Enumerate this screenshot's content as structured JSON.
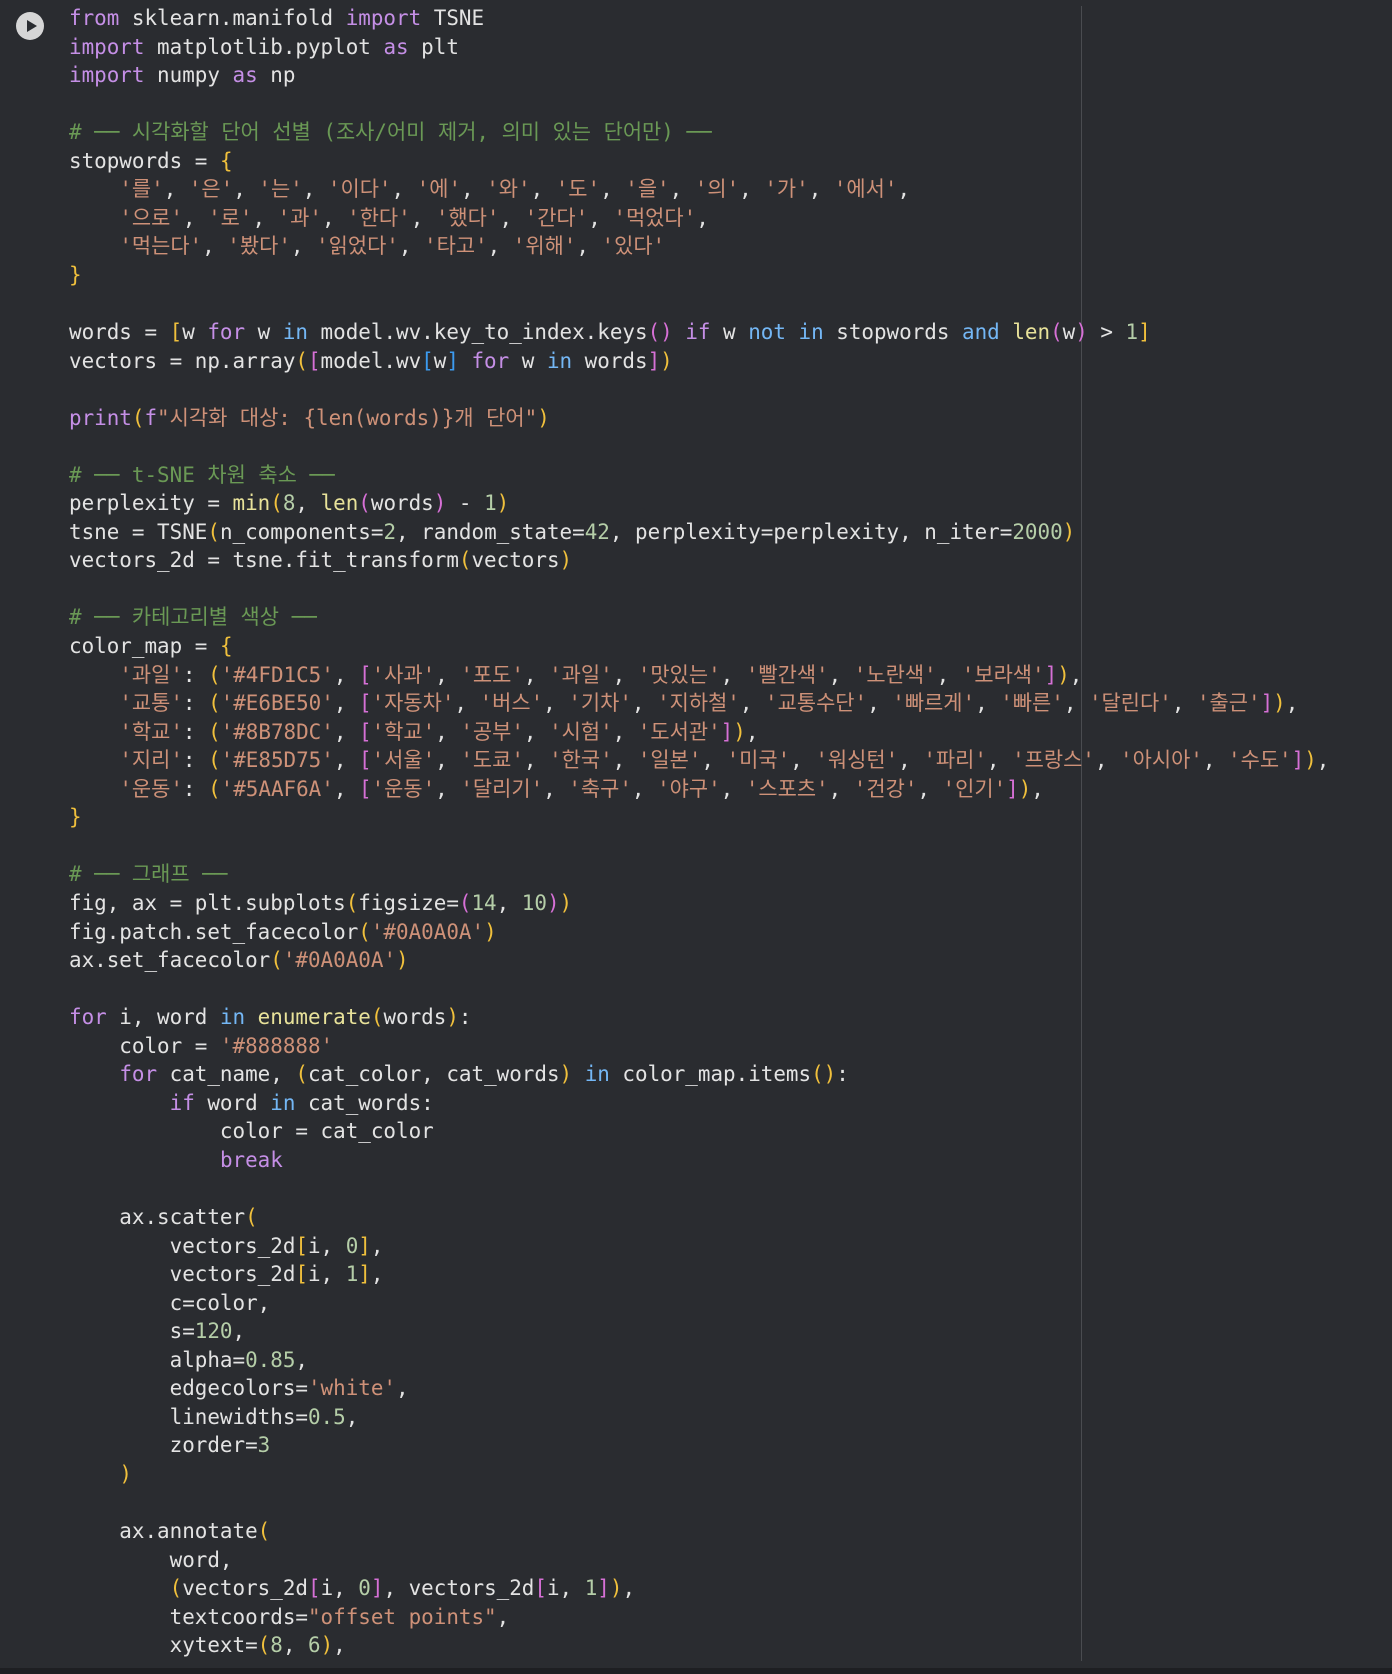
{
  "cell": {
    "run_icon": "play-icon",
    "lines": [
      "from sklearn.manifold import TSNE",
      "import matplotlib.pyplot as plt",
      "import numpy as np",
      "",
      "# ── 시각화할 단어 선별 (조사/어미 제거, 의미 있는 단어만) ──",
      "stopwords = {",
      "    '를', '은', '는', '이다', '에', '와', '도', '을', '의', '가', '에서',",
      "    '으로', '로', '과', '한다', '했다', '간다', '먹었다',",
      "    '먹는다', '봤다', '읽었다', '타고', '위해', '있다'",
      "}",
      "",
      "words = [w for w in model.wv.key_to_index.keys() if w not in stopwords and len(w) > 1]",
      "vectors = np.array([model.wv[w] for w in words])",
      "",
      "print(f\"시각화 대상: {len(words)}개 단어\")",
      "",
      "# ── t-SNE 차원 축소 ──",
      "perplexity = min(8, len(words) - 1)",
      "tsne = TSNE(n_components=2, random_state=42, perplexity=perplexity, n_iter=2000)",
      "vectors_2d = tsne.fit_transform(vectors)",
      "",
      "# ── 카테고리별 색상 ──",
      "color_map = {",
      "    '과일': ('#4FD1C5', ['사과', '포도', '과일', '맛있는', '빨간색', '노란색', '보라색']),",
      "    '교통': ('#E6BE50', ['자동차', '버스', '기차', '지하철', '교통수단', '빠르게', '빠른', '달린다', '출근']),",
      "    '학교': ('#8B78DC', ['학교', '공부', '시험', '도서관']),",
      "    '지리': ('#E85D75', ['서울', '도쿄', '한국', '일본', '미국', '워싱턴', '파리', '프랑스', '아시아', '수도']),",
      "    '운동': ('#5AAF6A', ['운동', '달리기', '축구', '야구', '스포츠', '건강', '인기']),",
      "}",
      "",
      "# ── 그래프 ──",
      "fig, ax = plt.subplots(figsize=(14, 10))",
      "fig.patch.set_facecolor('#0A0A0A')",
      "ax.set_facecolor('#0A0A0A')",
      "",
      "for i, word in enumerate(words):",
      "    color = '#888888'",
      "    for cat_name, (cat_color, cat_words) in color_map.items():",
      "        if word in cat_words:",
      "            color = cat_color",
      "            break",
      "",
      "    ax.scatter(",
      "        vectors_2d[i, 0],",
      "        vectors_2d[i, 1],",
      "        c=color,",
      "        s=120,",
      "        alpha=0.85,",
      "        edgecolors='white',",
      "        linewidths=0.5,",
      "        zorder=3",
      "    )",
      "",
      "    ax.annotate(",
      "        word,",
      "        (vectors_2d[i, 0], vectors_2d[i, 1]),",
      "        textcoords=\"offset points\",",
      "        xytext=(8, 6),"
    ]
  }
}
